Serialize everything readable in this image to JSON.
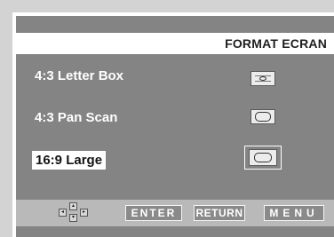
{
  "menu": {
    "title": "FORMAT ECRAN",
    "options": [
      {
        "label": "4:3 Letter Box",
        "icon": "letterbox-icon",
        "selected": false
      },
      {
        "label": "4:3 Pan Scan",
        "icon": "panscan-icon",
        "selected": false
      },
      {
        "label": "16:9 Large",
        "icon": "widescreen-icon",
        "selected": true
      }
    ]
  },
  "footer": {
    "nav_icon": "directional-pad-icon",
    "enter_label": "ENTER",
    "return_label": "RETURN",
    "menu_label": "MENU"
  },
  "colors": {
    "background": "#848484",
    "title_bar": "#ffffff",
    "footer_bar": "#b9b9b9",
    "text": "#ffffff"
  }
}
